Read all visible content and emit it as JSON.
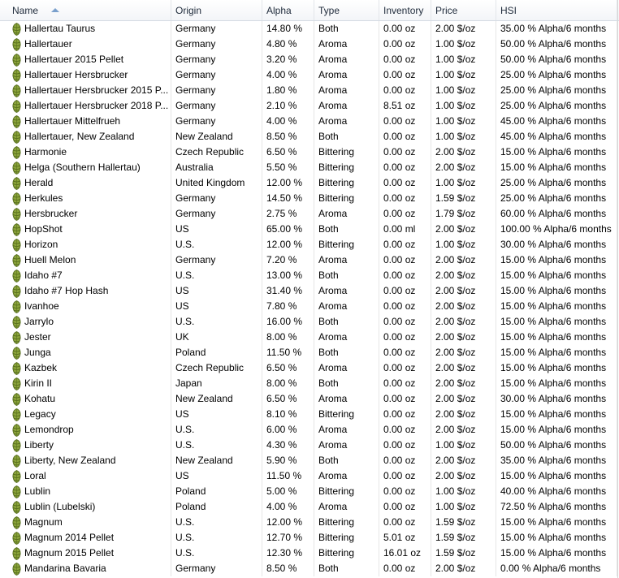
{
  "columns": {
    "name": "Name",
    "origin": "Origin",
    "alpha": "Alpha",
    "type": "Type",
    "inventory": "Inventory",
    "price": "Price",
    "hsi": "HSI"
  },
  "row_icon": "hop-icon",
  "sort_icon": "sort-ascending-icon",
  "rows": [
    {
      "name": "Hallertau Taurus",
      "origin": "Germany",
      "alpha": "14.80 %",
      "type": "Both",
      "inventory": "0.00 oz",
      "price": "2.00 $/oz",
      "hsi": "35.00 % Alpha/6 months"
    },
    {
      "name": "Hallertauer",
      "origin": "Germany",
      "alpha": "4.80 %",
      "type": "Aroma",
      "inventory": "0.00 oz",
      "price": "1.00 $/oz",
      "hsi": "50.00 % Alpha/6 months"
    },
    {
      "name": "Hallertauer 2015 Pellet",
      "origin": "Germany",
      "alpha": "3.20 %",
      "type": "Aroma",
      "inventory": "0.00 oz",
      "price": "1.00 $/oz",
      "hsi": "50.00 % Alpha/6 months"
    },
    {
      "name": "Hallertauer Hersbrucker",
      "origin": "Germany",
      "alpha": "4.00 %",
      "type": "Aroma",
      "inventory": "0.00 oz",
      "price": "1.00 $/oz",
      "hsi": "25.00 % Alpha/6 months"
    },
    {
      "name": "Hallertauer Hersbrucker 2015 P...",
      "origin": "Germany",
      "alpha": "1.80 %",
      "type": "Aroma",
      "inventory": "0.00 oz",
      "price": "1.00 $/oz",
      "hsi": "25.00 % Alpha/6 months"
    },
    {
      "name": "Hallertauer Hersbrucker 2018 P...",
      "origin": "Germany",
      "alpha": "2.10 %",
      "type": "Aroma",
      "inventory": "8.51 oz",
      "price": "1.00 $/oz",
      "hsi": "25.00 % Alpha/6 months"
    },
    {
      "name": "Hallertauer Mittelfrueh",
      "origin": "Germany",
      "alpha": "4.00 %",
      "type": "Aroma",
      "inventory": "0.00 oz",
      "price": "1.00 $/oz",
      "hsi": "45.00 % Alpha/6 months"
    },
    {
      "name": "Hallertauer, New Zealand",
      "origin": "New Zealand",
      "alpha": "8.50 %",
      "type": "Both",
      "inventory": "0.00 oz",
      "price": "1.00 $/oz",
      "hsi": "45.00 % Alpha/6 months"
    },
    {
      "name": "Harmonie",
      "origin": "Czech Republic",
      "alpha": "6.50 %",
      "type": "Bittering",
      "inventory": "0.00 oz",
      "price": "2.00 $/oz",
      "hsi": "15.00 % Alpha/6 months"
    },
    {
      "name": "Helga (Southern Hallertau)",
      "origin": "Australia",
      "alpha": "5.50 %",
      "type": "Bittering",
      "inventory": "0.00 oz",
      "price": "2.00 $/oz",
      "hsi": "15.00 % Alpha/6 months"
    },
    {
      "name": "Herald",
      "origin": "United Kingdom",
      "alpha": "12.00 %",
      "type": "Bittering",
      "inventory": "0.00 oz",
      "price": "1.00 $/oz",
      "hsi": "25.00 % Alpha/6 months"
    },
    {
      "name": "Herkules",
      "origin": "Germany",
      "alpha": "14.50 %",
      "type": "Bittering",
      "inventory": "0.00 oz",
      "price": "1.59 $/oz",
      "hsi": "25.00 % Alpha/6 months"
    },
    {
      "name": "Hersbrucker",
      "origin": "Germany",
      "alpha": "2.75 %",
      "type": "Aroma",
      "inventory": "0.00 oz",
      "price": "1.79 $/oz",
      "hsi": "60.00 % Alpha/6 months"
    },
    {
      "name": "HopShot",
      "origin": "US",
      "alpha": "65.00 %",
      "type": "Both",
      "inventory": "0.00 ml",
      "price": "2.00 $/oz",
      "hsi": "100.00 % Alpha/6 months"
    },
    {
      "name": "Horizon",
      "origin": "U.S.",
      "alpha": "12.00 %",
      "type": "Bittering",
      "inventory": "0.00 oz",
      "price": "1.00 $/oz",
      "hsi": "30.00 % Alpha/6 months"
    },
    {
      "name": "Huell Melon",
      "origin": "Germany",
      "alpha": "7.20 %",
      "type": "Aroma",
      "inventory": "0.00 oz",
      "price": "2.00 $/oz",
      "hsi": "15.00 % Alpha/6 months"
    },
    {
      "name": "Idaho #7",
      "origin": "U.S.",
      "alpha": "13.00 %",
      "type": "Both",
      "inventory": "0.00 oz",
      "price": "2.00 $/oz",
      "hsi": "15.00 % Alpha/6 months"
    },
    {
      "name": "Idaho #7 Hop Hash",
      "origin": "US",
      "alpha": "31.40 %",
      "type": "Aroma",
      "inventory": "0.00 oz",
      "price": "2.00 $/oz",
      "hsi": "15.00 % Alpha/6 months"
    },
    {
      "name": "Ivanhoe",
      "origin": "US",
      "alpha": "7.80 %",
      "type": "Aroma",
      "inventory": "0.00 oz",
      "price": "2.00 $/oz",
      "hsi": "15.00 % Alpha/6 months"
    },
    {
      "name": "Jarrylo",
      "origin": "U.S.",
      "alpha": "16.00 %",
      "type": "Both",
      "inventory": "0.00 oz",
      "price": "2.00 $/oz",
      "hsi": "15.00 % Alpha/6 months"
    },
    {
      "name": "Jester",
      "origin": "UK",
      "alpha": "8.00 %",
      "type": "Aroma",
      "inventory": "0.00 oz",
      "price": "2.00 $/oz",
      "hsi": "15.00 % Alpha/6 months"
    },
    {
      "name": "Junga",
      "origin": "Poland",
      "alpha": "11.50 %",
      "type": "Both",
      "inventory": "0.00 oz",
      "price": "2.00 $/oz",
      "hsi": "15.00 % Alpha/6 months"
    },
    {
      "name": "Kazbek",
      "origin": "Czech Republic",
      "alpha": "6.50 %",
      "type": "Aroma",
      "inventory": "0.00 oz",
      "price": "2.00 $/oz",
      "hsi": "15.00 % Alpha/6 months"
    },
    {
      "name": "Kirin II",
      "origin": "Japan",
      "alpha": "8.00 %",
      "type": "Both",
      "inventory": "0.00 oz",
      "price": "2.00 $/oz",
      "hsi": "15.00 % Alpha/6 months"
    },
    {
      "name": "Kohatu",
      "origin": "New Zealand",
      "alpha": "6.50 %",
      "type": "Aroma",
      "inventory": "0.00 oz",
      "price": "2.00 $/oz",
      "hsi": "30.00 % Alpha/6 months"
    },
    {
      "name": "Legacy",
      "origin": "US",
      "alpha": "8.10 %",
      "type": "Bittering",
      "inventory": "0.00 oz",
      "price": "2.00 $/oz",
      "hsi": "15.00 % Alpha/6 months"
    },
    {
      "name": "Lemondrop",
      "origin": "U.S.",
      "alpha": "6.00 %",
      "type": "Aroma",
      "inventory": "0.00 oz",
      "price": "2.00 $/oz",
      "hsi": "15.00 % Alpha/6 months"
    },
    {
      "name": "Liberty",
      "origin": "U.S.",
      "alpha": "4.30 %",
      "type": "Aroma",
      "inventory": "0.00 oz",
      "price": "1.00 $/oz",
      "hsi": "50.00 % Alpha/6 months"
    },
    {
      "name": "Liberty, New Zealand",
      "origin": "New Zealand",
      "alpha": "5.90 %",
      "type": "Both",
      "inventory": "0.00 oz",
      "price": "2.00 $/oz",
      "hsi": "35.00 % Alpha/6 months"
    },
    {
      "name": "Loral",
      "origin": "US",
      "alpha": "11.50 %",
      "type": "Aroma",
      "inventory": "0.00 oz",
      "price": "2.00 $/oz",
      "hsi": "15.00 % Alpha/6 months"
    },
    {
      "name": "Lublin",
      "origin": "Poland",
      "alpha": "5.00 %",
      "type": "Bittering",
      "inventory": "0.00 oz",
      "price": "1.00 $/oz",
      "hsi": "40.00 % Alpha/6 months"
    },
    {
      "name": "Lublin (Lubelski)",
      "origin": "Poland",
      "alpha": "4.00 %",
      "type": "Aroma",
      "inventory": "0.00 oz",
      "price": "1.00 $/oz",
      "hsi": "72.50 % Alpha/6 months"
    },
    {
      "name": "Magnum",
      "origin": "U.S.",
      "alpha": "12.00 %",
      "type": "Bittering",
      "inventory": "0.00 oz",
      "price": "1.59 $/oz",
      "hsi": "15.00 % Alpha/6 months"
    },
    {
      "name": "Magnum 2014 Pellet",
      "origin": "U.S.",
      "alpha": "12.70 %",
      "type": "Bittering",
      "inventory": "5.01 oz",
      "price": "1.59 $/oz",
      "hsi": "15.00 % Alpha/6 months"
    },
    {
      "name": "Magnum 2015 Pellet",
      "origin": "U.S.",
      "alpha": "12.30 %",
      "type": "Bittering",
      "inventory": "16.01 oz",
      "price": "1.59 $/oz",
      "hsi": "15.00 % Alpha/6 months"
    },
    {
      "name": "Mandarina Bavaria",
      "origin": "Germany",
      "alpha": "8.50 %",
      "type": "Both",
      "inventory": "0.00 oz",
      "price": "2.00 $/oz",
      "hsi": "0.00 % Alpha/6 months"
    }
  ]
}
